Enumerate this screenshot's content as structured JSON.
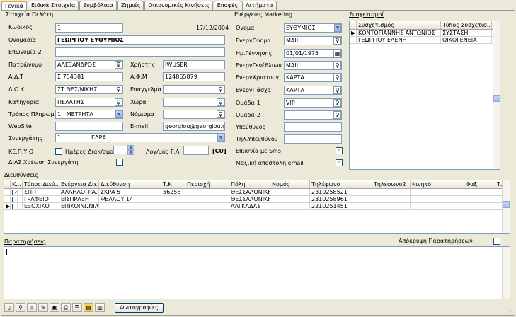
{
  "tabs": [
    "Γενικά",
    "Ειδικά Στοιχεία",
    "Συμβόλαια",
    "Ζημιές",
    "Οικονομικές Κινήσεις",
    "Επαφές",
    "Αιτήματα"
  ],
  "client": {
    "group_title": "Στοιχεία Πελάτη",
    "code_label": "Κωδικός",
    "code": "1",
    "date": "17/12/2004",
    "name_label": "Ονομασία",
    "name": "ΓΕΩΡΓΙΟΥ ΕΥΘΥΜΙΟΣ",
    "surname2_label": "Επωνυμία-2",
    "surname2": "",
    "father_label": "Πατρώνυμο",
    "father": "ΑΛΕΞΑΝΔΡΟΣ",
    "user_label": "Χρήστης",
    "user": "IWUSER",
    "id_label": "Α.Δ.Τ",
    "id": "Σ 754381",
    "afm_label": "Α.Φ.Μ",
    "afm": "124865879",
    "doy_label": "Δ.Ο.Υ",
    "doy": "ΣΤ ΘΕΣ/ΝΙΚΗΣ",
    "profession_label": "Επαγγελμα",
    "profession": "",
    "category_label": "Κατηγορία",
    "category": "ΠΕΛΑΤΗΣ",
    "country_label": "Χώρα",
    "country": "",
    "payment_label": "Τρόπος Πληρωμής",
    "payment_code": "1",
    "payment": "ΜΕΤΡΗΤΑ",
    "currency_label": "Νόμισμα",
    "currency": "",
    "website_label": "WebSite",
    "website": "",
    "email_label": "E-mail",
    "email": "georgiou@georgiou.gr",
    "partner_label": "Συνεργάτης",
    "partner_code": "1",
    "partner": "ΕΔΡΑ",
    "kepyo_label": "ΚΕ.Π.Υ.Ο",
    "days_label": "Ημέρες Διακ/σμού",
    "gl_label": "Λογ/μός Γ.Λ",
    "gl_value": "",
    "cu_label": "[CU]",
    "dias_label": "ΔΙΑΣ Χρέωση Συνεργάτη"
  },
  "marketing": {
    "group_title": "Ενέργειες Marketing",
    "name_label": "Όνομα",
    "name": "ΕΥΘΥΜΙΟΣ",
    "nameday_label": "ΕνεργΟνομα",
    "nameday": "MAIL",
    "birth_label": "Ημ.Γέννησης",
    "birth": "01/01/1975",
    "birthact_label": "ΕνεργΓενέθλιων",
    "birthact": "MAIL",
    "xmas_label": "ΕνεργΧριστουγ",
    "xmas": "ΚΑΡΤΑ",
    "easter_label": "ΕνεργΠάσχα",
    "easter": "ΚΑΡΤΑ",
    "group1_label": "Ομάδα-1",
    "group1": "VIP",
    "group2_label": "Ομάδα-2",
    "group2": "",
    "resp_label": "Υπεύθυνος",
    "resp": "",
    "resptel_label": "Τηλ.Υπευθύνου",
    "resptel": "",
    "sms_label": "Επικ/νία με Sms",
    "mass_label": "Μαζική αποστολή email"
  },
  "relations": {
    "title": "Συσχετισμοί",
    "headers": [
      "Συσχετισμός",
      "Τύπος Συσχετισ..."
    ],
    "rows": [
      [
        "ΚΟΝΤΟΓΙΑΝΝΗΣ ΑΝΤΩΝΙΟΣ",
        "ΣΥΣΤΑΣΗ"
      ],
      [
        "ΓΕΩΡΓΙΟΥ ΕΛΕΝΗ",
        "ΟΙΚΟΓΕΝΕΙΑ"
      ]
    ]
  },
  "addresses": {
    "title": "Διευθύνσεις",
    "headers": [
      "Κ...",
      "Τύπος Διεύ...",
      "Ενέργεια Διε...",
      "Διεύθυνση",
      "Τ.Κ",
      "Περιοχή",
      "Πόλη",
      "Νομός",
      "Τηλέφωνο",
      "Τηλέφωνο2",
      "Κινητό",
      "Φαξ",
      "Τ.Θ."
    ],
    "rows": [
      {
        "type": "ΣΠΙΤΙ",
        "action": "ΑΛΛΗΛΟΓΡΑ...",
        "address": "ΣΚΡΑ 5",
        "zip": "56258",
        "area": "",
        "city": "ΘΕΣΣΑΛΟΝΙΚΗ",
        "prefecture": "",
        "phone": "2310258521"
      },
      {
        "type": "ΓΡΑΦΕΙΟ",
        "action": "ΕΙΣΠΡΑΞΗ",
        "address": "ΨΕΛΛΟΥ 14",
        "zip": "",
        "area": "",
        "city": "ΘΕΣΣΑΛΟΝΙΚΗ",
        "prefecture": "",
        "phone": "2310258961"
      },
      {
        "type": "ΕΞΟΧΙΚΟ",
        "action": "ΕΠΙΚΟΙΝΩΝΙΑ",
        "address": "",
        "zip": "",
        "area": "",
        "city": "ΛΑΓΚΑΔΑΣ",
        "prefecture": "",
        "phone": "2210251451"
      }
    ]
  },
  "notes": {
    "title": "Παρατηρήσεις",
    "hide_label": "Απόκρυψη Παρατηρήσεων"
  },
  "toolbar": {
    "photos": "Φωτογραφίες"
  }
}
